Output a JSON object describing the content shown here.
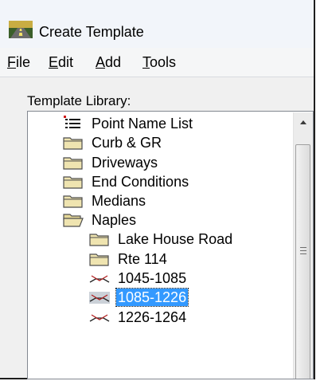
{
  "window": {
    "title": "Create Template"
  },
  "menubar": {
    "items": [
      {
        "mnemonic": "F",
        "rest": "ile"
      },
      {
        "mnemonic": "E",
        "rest": "dit"
      },
      {
        "mnemonic": "A",
        "rest": "dd"
      },
      {
        "mnemonic": "T",
        "rest": "ools"
      }
    ]
  },
  "library": {
    "label": "Template Library:",
    "items": [
      {
        "label": "Point Name List",
        "icon": "point-name-list-icon",
        "level": 0
      },
      {
        "label": "Curb & GR",
        "icon": "folder-icon",
        "level": 0
      },
      {
        "label": "Driveways",
        "icon": "folder-icon",
        "level": 0
      },
      {
        "label": "End Conditions",
        "icon": "folder-icon",
        "level": 0
      },
      {
        "label": "Medians",
        "icon": "folder-icon",
        "level": 0
      },
      {
        "label": "Naples",
        "icon": "folder-open-icon",
        "level": 0,
        "expanded": true
      },
      {
        "label": "Lake House Road",
        "icon": "folder-icon",
        "level": 1
      },
      {
        "label": "Rte 114",
        "icon": "folder-icon",
        "level": 1
      },
      {
        "label": "1045-1085",
        "icon": "template-icon",
        "level": 1
      },
      {
        "label": "1085-1226",
        "icon": "template-icon",
        "level": 1,
        "selected": true
      },
      {
        "label": "1226-1264",
        "icon": "template-icon",
        "level": 1
      }
    ]
  },
  "colors": {
    "selection": "#3399ff",
    "folder_fill": "#efe4b0",
    "template_mark": "#b01c1c"
  }
}
